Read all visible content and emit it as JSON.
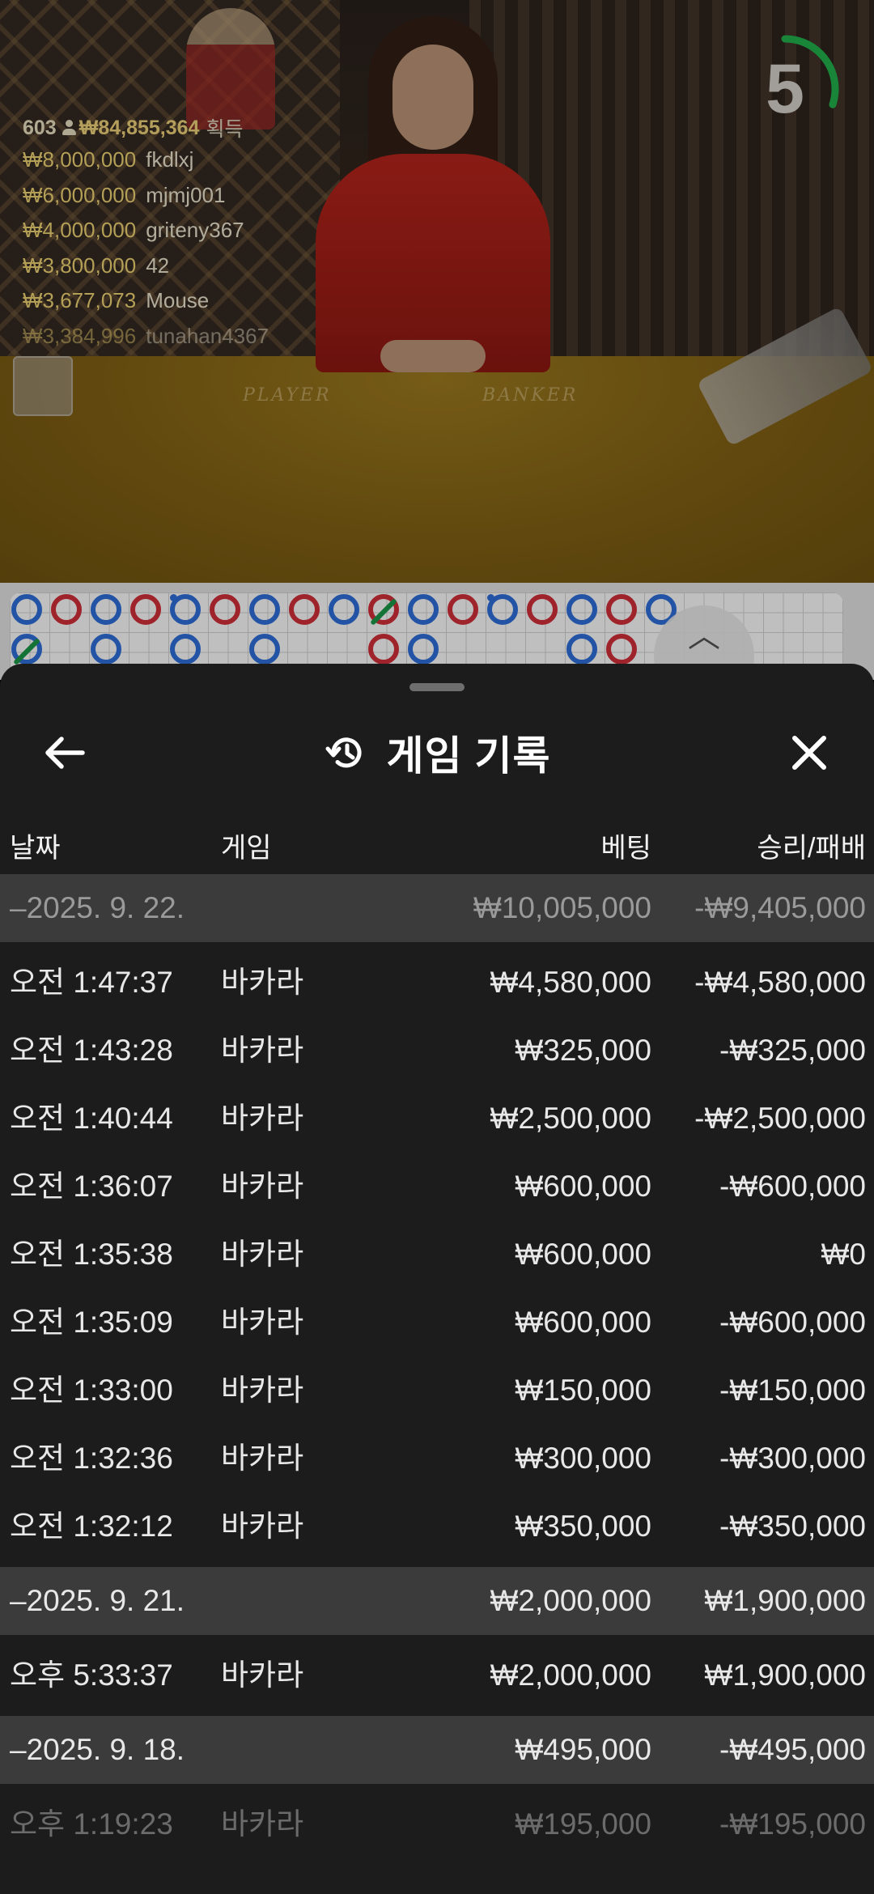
{
  "live": {
    "winners_count": "603",
    "winners_total": "₩84,855,364",
    "winners_suffix": "획득",
    "winners": [
      {
        "amount": "₩8,000,000",
        "name": "fkdlxj"
      },
      {
        "amount": "₩6,000,000",
        "name": "mjmj001"
      },
      {
        "amount": "₩4,000,000",
        "name": "griteny367"
      },
      {
        "amount": "₩3,800,000",
        "name": "42"
      },
      {
        "amount": "₩3,677,073",
        "name": "Mouse"
      },
      {
        "amount": "₩3,384,996",
        "name": "tunahan4367"
      }
    ],
    "timer": "5",
    "timer_progress": 0.3,
    "felt_player": "PLAYER",
    "felt_banker": "BANKER"
  },
  "colors": {
    "timer_ring": "#22b24c",
    "player_blue": "#2f6fdc",
    "banker_red": "#d42f3a",
    "tie_green": "#1b9a4a",
    "sheet_bg": "#1c1c1c",
    "group_row_bg": "#3b3b3b"
  },
  "history": {
    "title": "게임 기록",
    "icons": {
      "back": "arrow-left-icon",
      "history": "history-icon",
      "close": "close-icon"
    },
    "columns": {
      "date": "날짜",
      "game": "게임",
      "bet": "베팅",
      "result": "승리/패배"
    },
    "groups": [
      {
        "date": "–2025. 9. 22.",
        "bet": "₩10,005,000",
        "result": "-₩9,405,000",
        "rows": [
          {
            "time": "오전 1:47:37",
            "game": "바카라",
            "bet": "₩4,580,000",
            "result": "-₩4,580,000"
          },
          {
            "time": "오전 1:43:28",
            "game": "바카라",
            "bet": "₩325,000",
            "result": "-₩325,000"
          },
          {
            "time": "오전 1:40:44",
            "game": "바카라",
            "bet": "₩2,500,000",
            "result": "-₩2,500,000"
          },
          {
            "time": "오전 1:36:07",
            "game": "바카라",
            "bet": "₩600,000",
            "result": "-₩600,000"
          },
          {
            "time": "오전 1:35:38",
            "game": "바카라",
            "bet": "₩600,000",
            "result": "₩0"
          },
          {
            "time": "오전 1:35:09",
            "game": "바카라",
            "bet": "₩600,000",
            "result": "-₩600,000"
          },
          {
            "time": "오전 1:33:00",
            "game": "바카라",
            "bet": "₩150,000",
            "result": "-₩150,000"
          },
          {
            "time": "오전 1:32:36",
            "game": "바카라",
            "bet": "₩300,000",
            "result": "-₩300,000"
          },
          {
            "time": "오전 1:32:12",
            "game": "바카라",
            "bet": "₩350,000",
            "result": "-₩350,000"
          }
        ]
      },
      {
        "date": "–2025. 9. 21.",
        "bet": "₩2,000,000",
        "result": "₩1,900,000",
        "rows": [
          {
            "time": "오후 5:33:37",
            "game": "바카라",
            "bet": "₩2,000,000",
            "result": "₩1,900,000"
          }
        ]
      },
      {
        "date": "–2025. 9. 18.",
        "bet": "₩495,000",
        "result": "-₩495,000",
        "rows": [
          {
            "time": "오후 1:19:23",
            "game": "바카라",
            "bet": "₩195,000",
            "result": "-₩195,000"
          }
        ]
      }
    ]
  }
}
